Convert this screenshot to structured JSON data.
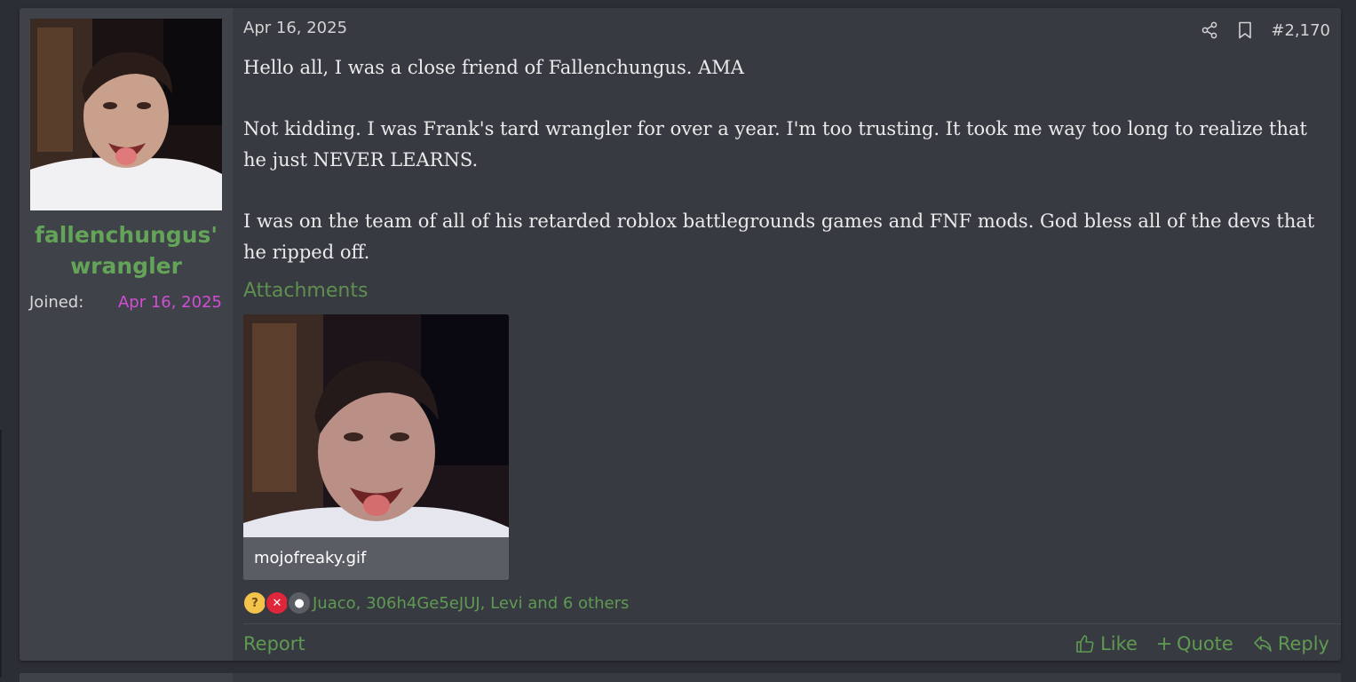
{
  "user": {
    "username": "fallenchungus' wrangler",
    "joined_label": "Joined:",
    "joined_value": "Apr 16, 2025"
  },
  "post": {
    "date": "Apr 16, 2025",
    "number": "#2,170",
    "paragraphs": [
      "Hello all, I was a close friend of Fallenchungus. AMA",
      "Not kidding. I was Frank's tard wrangler for over a year. I'm too trusting. It took me way too long to realize that he just NEVER LEARNS.",
      "I was on the team of all of his retarded roblox battlegrounds games and FNF mods. God bless all of the devs that he ripped off."
    ],
    "attachments_title": "Attachments",
    "attachment_filename": "mojofreaky.gif",
    "reactions_text": "Juaco, 306h4Ge5eJUJ, Levi and 6 others"
  },
  "actions": {
    "report": "Report",
    "like": "Like",
    "quote": "Quote",
    "reply": "Reply"
  },
  "colors": {
    "username": "#63a458",
    "joined_value": "#d24ed6",
    "link_green": "#5f9a53",
    "panel": "#373a41",
    "user_panel": "#3f4249"
  },
  "icons": [
    "share-icon",
    "bookmark-icon",
    "thumbs-up-icon",
    "plus-icon",
    "reply-arrow-icon",
    "thinking-face-icon",
    "cross-icon",
    "misc-reaction-icon"
  ]
}
